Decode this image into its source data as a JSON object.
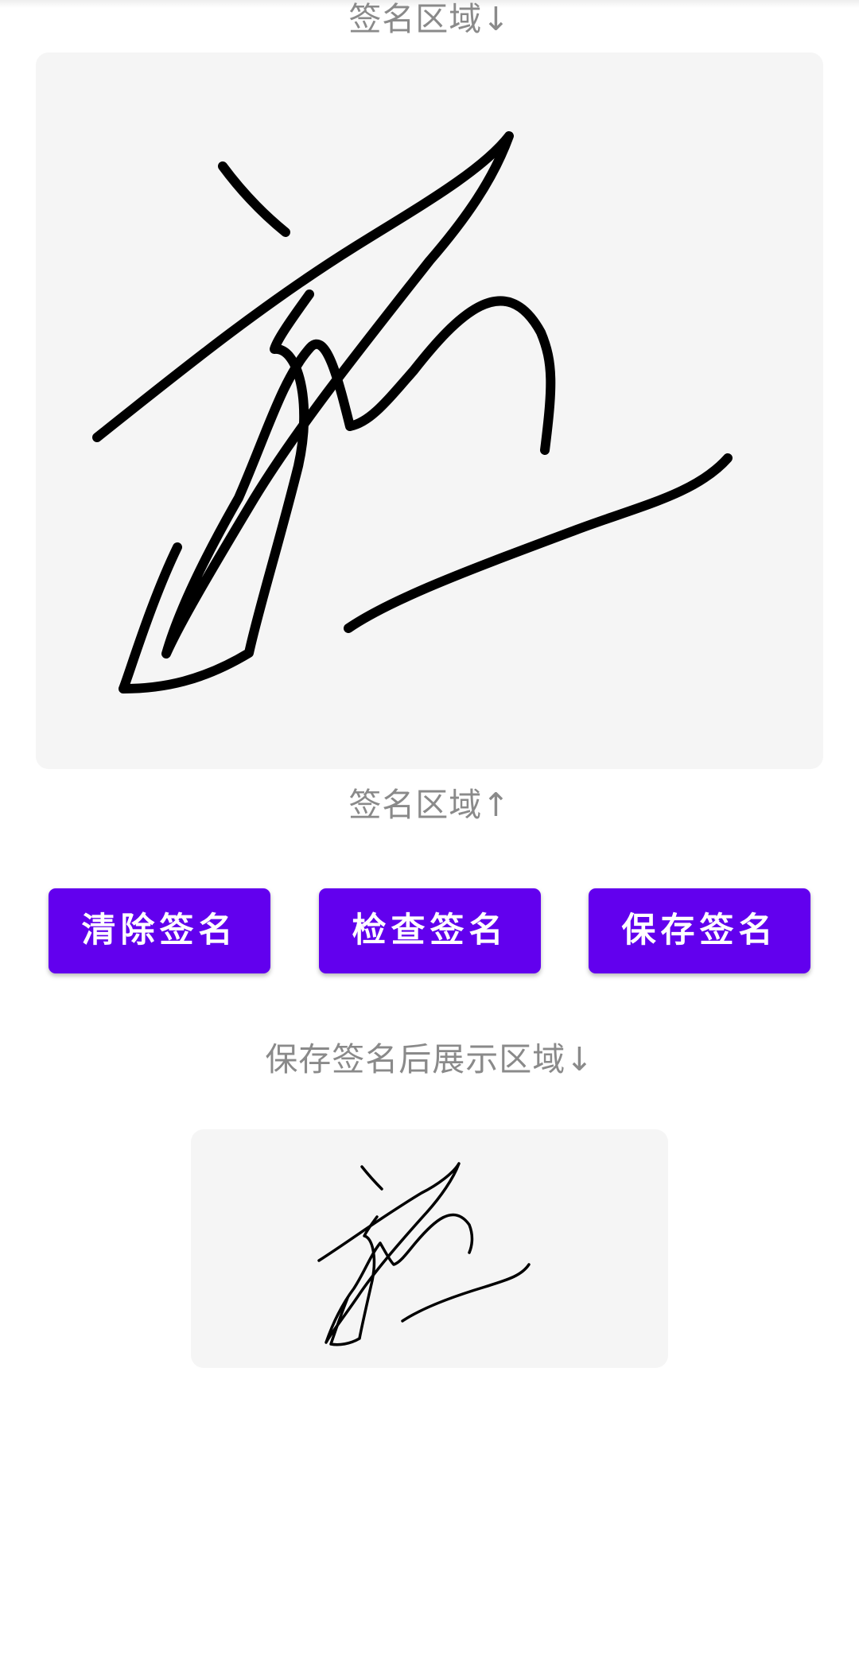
{
  "captions": {
    "signature_top": "签名区域↓",
    "signature_bottom": "签名区域↑",
    "saved_preview": "保存签名后展示区域↓"
  },
  "buttons": {
    "clear": "清除签名",
    "check": "检查签名",
    "save": "保存签名"
  },
  "colors": {
    "accent": "#6200ee",
    "panel_bg": "#f5f5f5",
    "caption_text": "#8a8a8a",
    "ink": "#000000"
  }
}
